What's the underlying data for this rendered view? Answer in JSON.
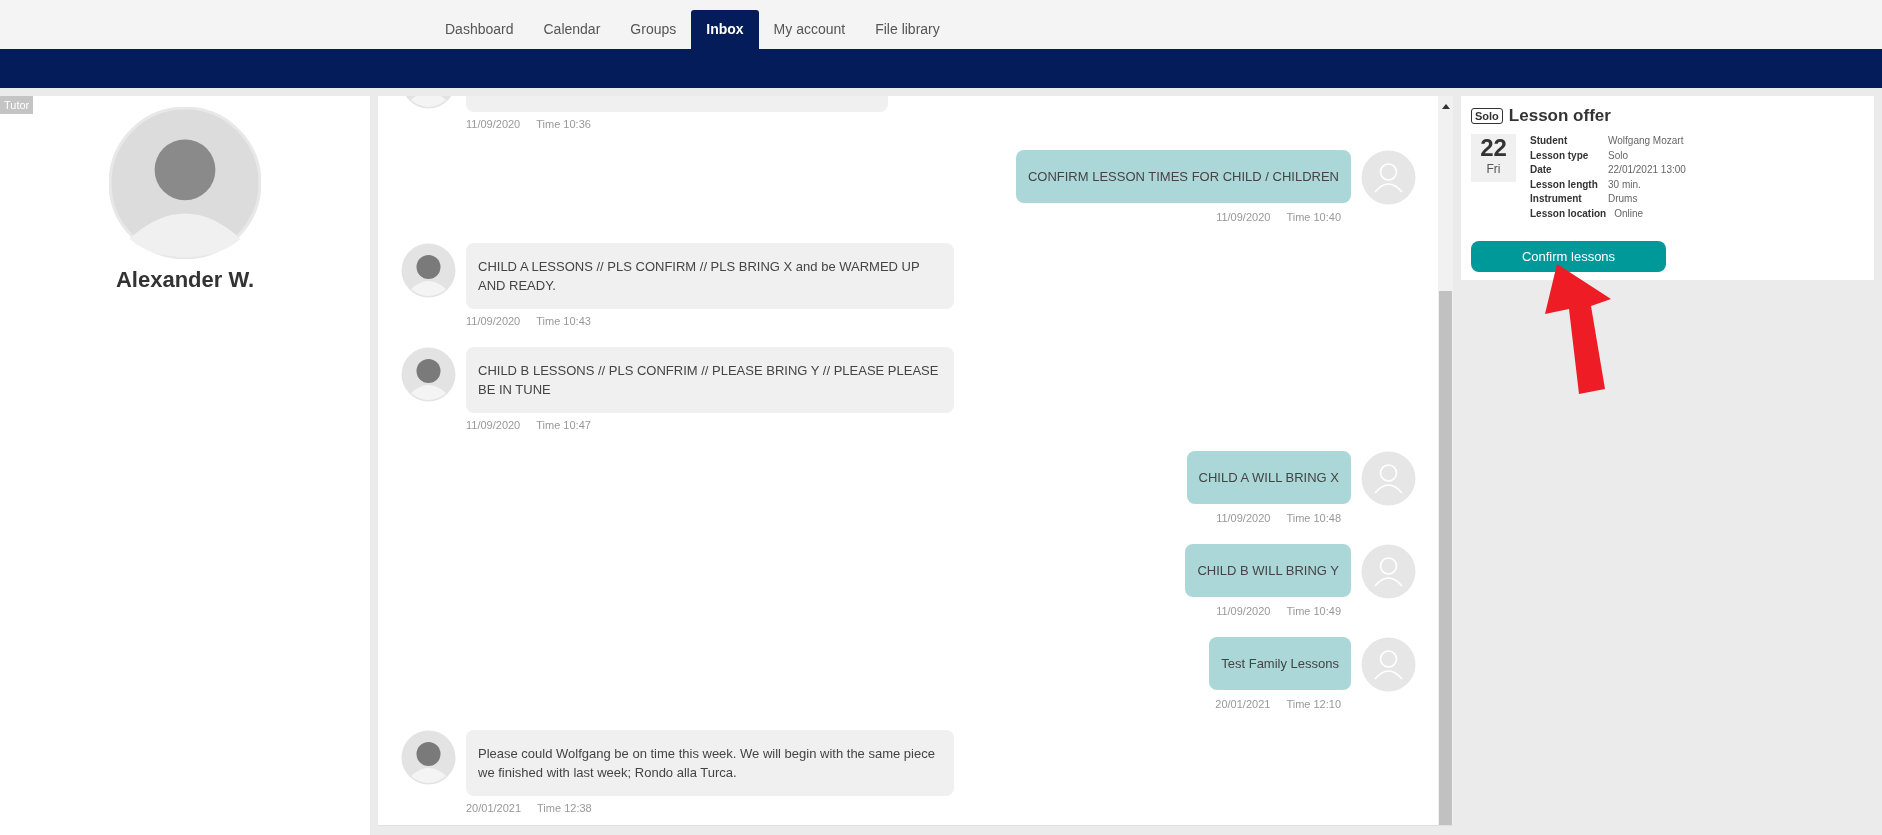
{
  "nav": {
    "tabs": [
      {
        "label": "Dashboard",
        "selected": false
      },
      {
        "label": "Calendar",
        "selected": false
      },
      {
        "label": "Groups",
        "selected": false
      },
      {
        "label": "Inbox",
        "selected": true
      },
      {
        "label": "My account",
        "selected": false
      },
      {
        "label": "File library",
        "selected": false
      }
    ]
  },
  "profile": {
    "role": "Tutor",
    "name": "Alexander W."
  },
  "messages": [
    {
      "kind": "incoming",
      "date": "11/09/2020",
      "time": "Time 10:36"
    },
    {
      "kind": "outgoing",
      "text": "CONFIRM LESSON TIMES FOR CHILD / CHILDREN",
      "date": "11/09/2020",
      "time": "Time 10:40"
    },
    {
      "kind": "incoming",
      "text": "CHILD A LESSONS // PLS CONFIRM // PLS BRING X and be WARMED UP AND READY.",
      "date": "11/09/2020",
      "time": "Time 10:43"
    },
    {
      "kind": "incoming",
      "text": "CHILD B LESSONS // PLS CONFRIM // PLEASE BRING Y // PLEASE PLEASE BE IN TUNE",
      "date": "11/09/2020",
      "time": "Time 10:47"
    },
    {
      "kind": "outgoing",
      "text": "CHILD A WILL BRING X",
      "date": "11/09/2020",
      "time": "Time 10:48"
    },
    {
      "kind": "outgoing",
      "text": "CHILD B WILL BRING Y",
      "date": "11/09/2020",
      "time": "Time 10:49"
    },
    {
      "kind": "outgoing",
      "text": "Test Family Lessons",
      "date": "20/01/2021",
      "time": "Time 12:10"
    },
    {
      "kind": "incoming",
      "text": "Please could Wolfgang be on time this week. We will begin with the same piece we finished with last week; Rondo alla Turca.",
      "date": "20/01/2021",
      "time": "Time 12:38"
    }
  ],
  "offer": {
    "badge": "Solo",
    "title": "Lesson offer",
    "day": "22",
    "weekday": "Fri",
    "details": [
      {
        "label": "Student",
        "value": "Wolfgang Mozart"
      },
      {
        "label": "Lesson type",
        "value": "Solo"
      },
      {
        "label": "Date",
        "value": "22/01/2021 13:00"
      },
      {
        "label": "Lesson length",
        "value": "30 min."
      },
      {
        "label": "Instrument",
        "value": "Drums"
      },
      {
        "label": "Lesson location",
        "value": "Online"
      }
    ],
    "button": "Confirm lessons"
  }
}
